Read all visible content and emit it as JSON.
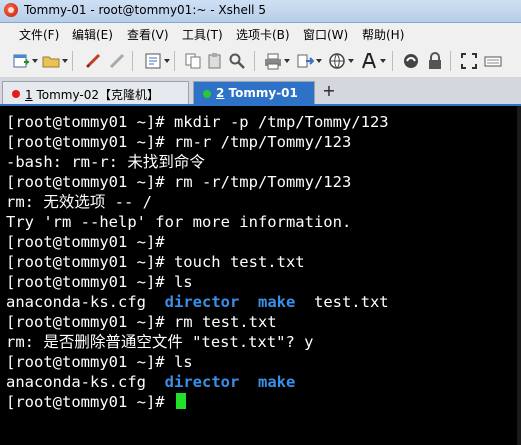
{
  "window": {
    "title": "Tommy-01 - root@tommy01:~ - Xshell 5"
  },
  "menu": [
    "文件(F)",
    "编辑(E)",
    "查看(V)",
    "工具(T)",
    "选项卡(B)",
    "窗口(W)",
    "帮助(H)"
  ],
  "toolbar_icons": [
    "new-session-icon",
    "open-folder-icon",
    "disconnect-icon",
    "reconnect-icon",
    "properties-icon",
    "copy-icon",
    "paste-icon",
    "find-icon",
    "print-icon",
    "transfer-icon",
    "globe-icon",
    "font-icon",
    "xftp-icon",
    "lock-icon",
    "fullscreen-icon"
  ],
  "tabs": [
    {
      "number": "1",
      "label": " Tommy-02【克隆机】",
      "status_color": "#e31b1b",
      "active": false
    },
    {
      "number": "2",
      "label": " Tommy-01",
      "status_color": "#28c933",
      "active": true
    }
  ],
  "add_tab_label": "+",
  "terminal": {
    "lines": [
      {
        "text": "[root@tommy01 ~]# mkdir -p /tmp/Tommy/123"
      },
      {
        "text": "[root@tommy01 ~]# rm-r /tmp/Tommy/123"
      },
      {
        "text": "-bash: rm-r: 未找到命令"
      },
      {
        "text": "[root@tommy01 ~]# rm -r/tmp/Tommy/123"
      },
      {
        "text": "rm: 无效选项 -- /"
      },
      {
        "text": "Try 'rm --help' for more information."
      },
      {
        "text": "[root@tommy01 ~]#"
      },
      {
        "text": "[root@tommy01 ~]# touch test.txt"
      },
      {
        "text": "[root@tommy01 ~]# ls"
      },
      {
        "file1": "anaconda-ks.cfg",
        "dir1": "director",
        "dir2": "make",
        "file2": "test.txt"
      },
      {
        "text": "[root@tommy01 ~]# rm test.txt"
      },
      {
        "text": "rm: 是否删除普通空文件 \"test.txt\"? y"
      },
      {
        "text": "[root@tommy01 ~]# ls"
      },
      {
        "file1": "anaconda-ks.cfg",
        "dir1": "director",
        "dir2": "make"
      },
      {
        "text": "[root@tommy01 ~]#"
      }
    ],
    "colors": {
      "text": "#ffffff",
      "directory": "#3b8fe8",
      "cursor": "#22e02a",
      "background": "#000000"
    }
  }
}
